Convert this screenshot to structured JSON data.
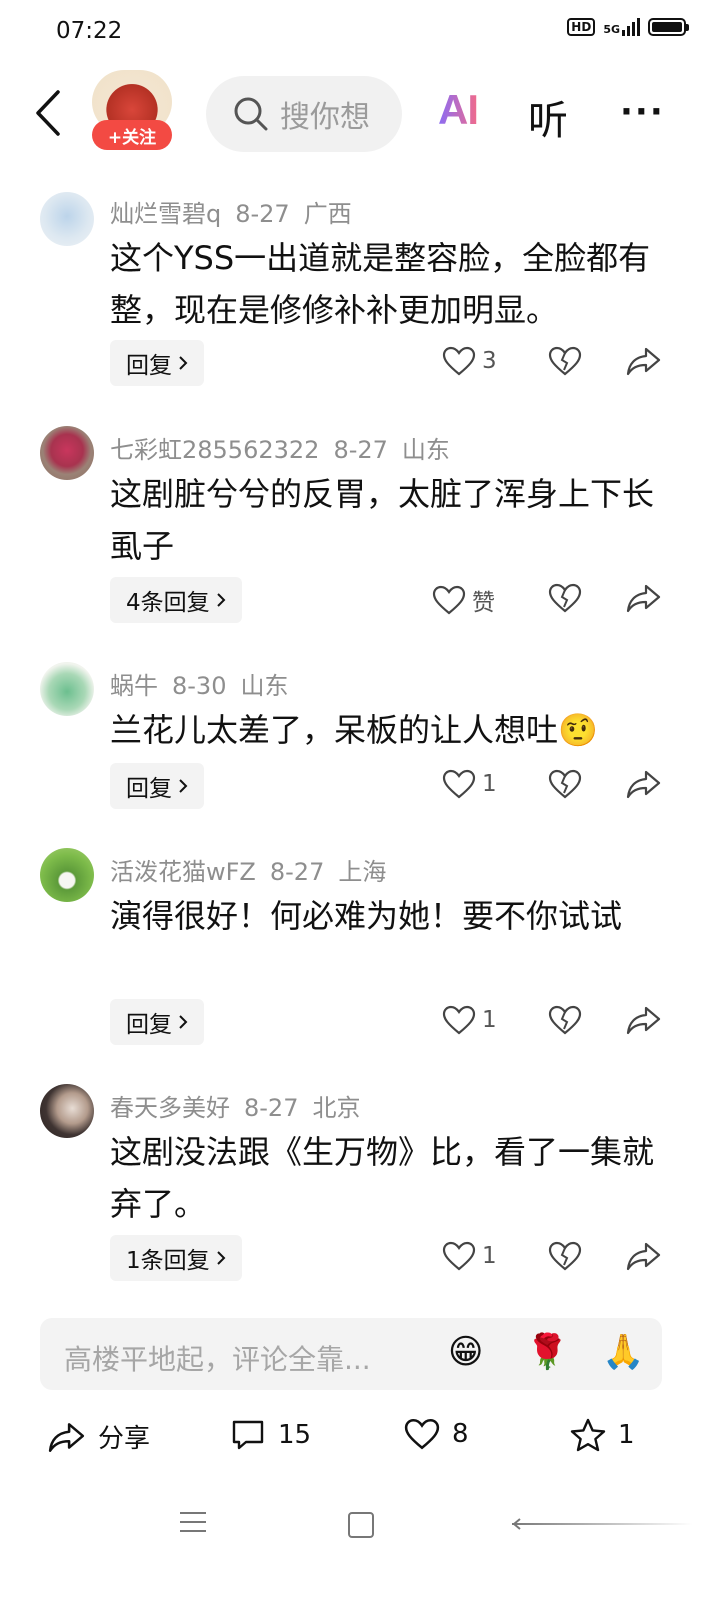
{
  "status_bar": {
    "time": "07:22",
    "hd": "HD",
    "network": "5G"
  },
  "top_nav": {
    "follow_label": "+关注",
    "search_placeholder": "搜你想",
    "ai_label": "AI",
    "listen_label": "听",
    "more_label": "···"
  },
  "comments": [
    {
      "user": "灿烂雪碧q",
      "date": "8-27",
      "region": "广西",
      "text": "这个YSS一出道就是整容脸，全脸都有整，现在是修修补补更加明显。",
      "reply_label": "回复",
      "like_label": "3"
    },
    {
      "user": "七彩虹285562322",
      "date": "8-27",
      "region": "山东",
      "text": "这剧脏兮兮的反胃，太脏了浑身上下长虱子",
      "reply_label": "4条回复",
      "like_label": "赞"
    },
    {
      "user": "蜗牛",
      "date": "8-30",
      "region": "山东",
      "text": "兰花儿太差了，呆板的让人想吐🤨",
      "reply_label": "回复",
      "like_label": "1"
    },
    {
      "user": "活泼花猫wFZ",
      "date": "8-27",
      "region": "上海",
      "text": "演得很好！何必难为她！要不你试试",
      "reply_label": "回复",
      "like_label": "1"
    },
    {
      "user": "春天多美好",
      "date": "8-27",
      "region": "北京",
      "text": "这剧没法跟《生万物》比，看了一集就弃了。",
      "reply_label": "1条回复",
      "like_label": "1"
    }
  ],
  "input_bar": {
    "placeholder": "高楼平地起，评论全靠...",
    "emojis": [
      "😁",
      "🌹",
      "🙏"
    ]
  },
  "bottom_bar": {
    "share_label": "分享",
    "comments_count": "15",
    "likes_count": "8",
    "favorites_count": "1"
  },
  "colors": {
    "accent_red": "#f34a43",
    "meta_gray": "#8e8e8e",
    "chip_bg": "#f3f3f3"
  },
  "icons": [
    "back-icon",
    "search-icon",
    "heart-icon",
    "broken-heart-icon",
    "share-icon",
    "comment-icon",
    "star-icon"
  ]
}
